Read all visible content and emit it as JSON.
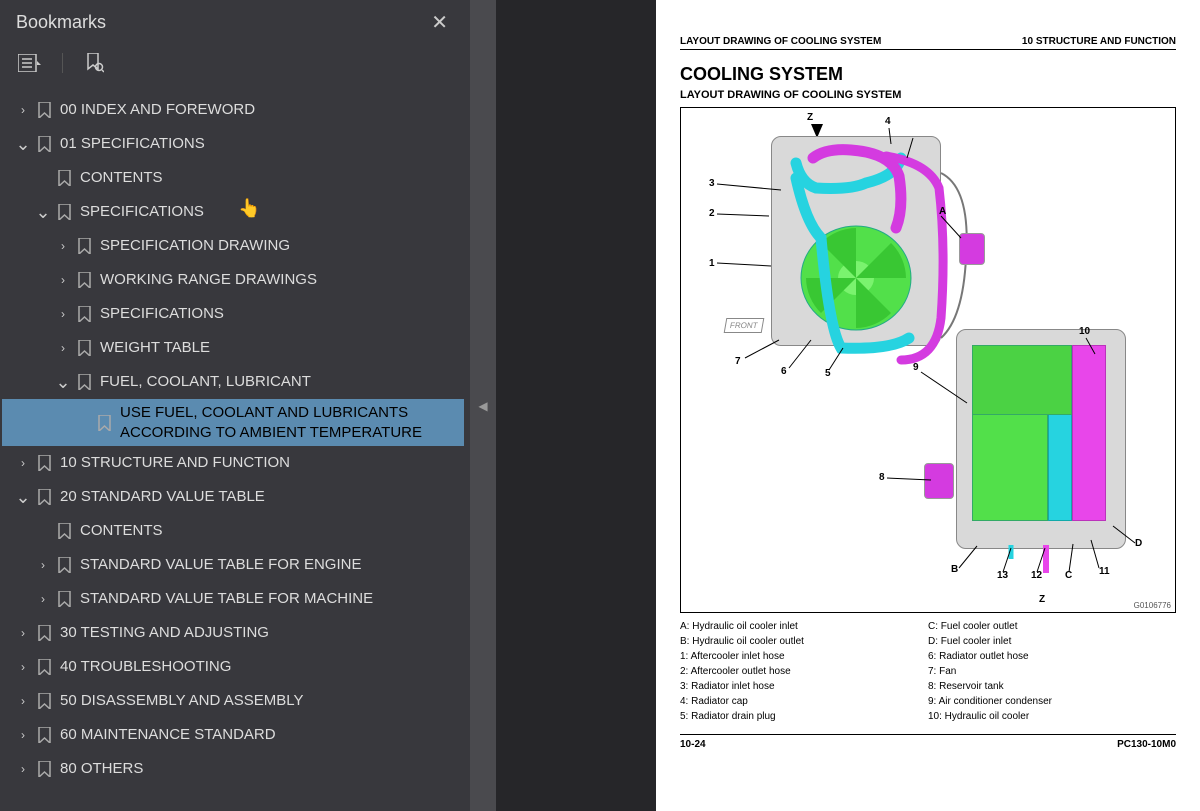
{
  "sidebar": {
    "title": "Bookmarks",
    "tree": [
      {
        "level": 0,
        "chev": "right",
        "label": "00 INDEX AND FOREWORD",
        "sel": false
      },
      {
        "level": 0,
        "chev": "down",
        "label": "01 SPECIFICATIONS",
        "sel": false
      },
      {
        "level": 1,
        "chev": "",
        "label": "CONTENTS",
        "sel": false
      },
      {
        "level": 1,
        "chev": "down",
        "label": "SPECIFICATIONS",
        "sel": false
      },
      {
        "level": 2,
        "chev": "right",
        "label": "SPECIFICATION DRAWING",
        "sel": false
      },
      {
        "level": 2,
        "chev": "right",
        "label": "WORKING RANGE DRAWINGS",
        "sel": false
      },
      {
        "level": 2,
        "chev": "right",
        "label": "SPECIFICATIONS",
        "sel": false
      },
      {
        "level": 2,
        "chev": "right",
        "label": "WEIGHT TABLE",
        "sel": false
      },
      {
        "level": 2,
        "chev": "down",
        "label": "FUEL, COOLANT, LUBRICANT",
        "sel": false
      },
      {
        "level": 3,
        "chev": "",
        "label": "USE FUEL, COOLANT AND LUBRICANTS ACCORDING TO AMBIENT TEMPERATURE",
        "sel": true
      },
      {
        "level": 0,
        "chev": "right",
        "label": "10 STRUCTURE AND FUNCTION",
        "sel": false
      },
      {
        "level": 0,
        "chev": "down",
        "label": "20 STANDARD VALUE TABLE",
        "sel": false
      },
      {
        "level": 1,
        "chev": "",
        "label": "CONTENTS",
        "sel": false
      },
      {
        "level": 1,
        "chev": "right",
        "label": "STANDARD VALUE TABLE FOR ENGINE",
        "sel": false
      },
      {
        "level": 1,
        "chev": "right",
        "label": "STANDARD VALUE TABLE FOR MACHINE",
        "sel": false
      },
      {
        "level": 0,
        "chev": "right",
        "label": "30 TESTING AND ADJUSTING",
        "sel": false
      },
      {
        "level": 0,
        "chev": "right",
        "label": "40 TROUBLESHOOTING",
        "sel": false
      },
      {
        "level": 0,
        "chev": "right",
        "label": "50 DISASSEMBLY AND ASSEMBLY",
        "sel": false
      },
      {
        "level": 0,
        "chev": "right",
        "label": "60 MAINTENANCE STANDARD",
        "sel": false
      },
      {
        "level": 0,
        "chev": "right",
        "label": "80 OTHERS",
        "sel": false
      }
    ]
  },
  "page": {
    "headerLeft": "LAYOUT DRAWING OF COOLING SYSTEM",
    "headerRight": "10 STRUCTURE AND FUNCTION",
    "title": "COOLING SYSTEM",
    "subtitle": "LAYOUT DRAWING OF COOLING SYSTEM",
    "figCode": "G0106776",
    "footerLeft": "10-24",
    "footerRight": "PC130-10M0",
    "legendLeft": [
      "A: Hydraulic oil cooler inlet",
      "B: Hydraulic oil cooler outlet",
      "1: Aftercooler inlet hose",
      "2: Aftercooler outlet hose",
      "3: Radiator inlet hose",
      "4: Radiator cap",
      "5: Radiator drain plug"
    ],
    "legendRight": [
      "C: Fuel cooler outlet",
      "D: Fuel cooler inlet",
      "6: Radiator outlet hose",
      "7: Fan",
      "8: Reservoir tank",
      "9: Air conditioner condenser",
      "10: Hydraulic oil cooler"
    ],
    "callouts": {
      "Ztop": "Z",
      "1": "1",
      "2": "2",
      "3": "3",
      "4": "4",
      "5": "5",
      "6": "6",
      "7": "7",
      "8": "8",
      "9": "9",
      "10": "10",
      "11": "11",
      "12": "12",
      "13": "13",
      "Atop": "A",
      "B": "B",
      "C": "C",
      "D": "D",
      "Zbot": "Z",
      "front": "FRONT"
    }
  }
}
